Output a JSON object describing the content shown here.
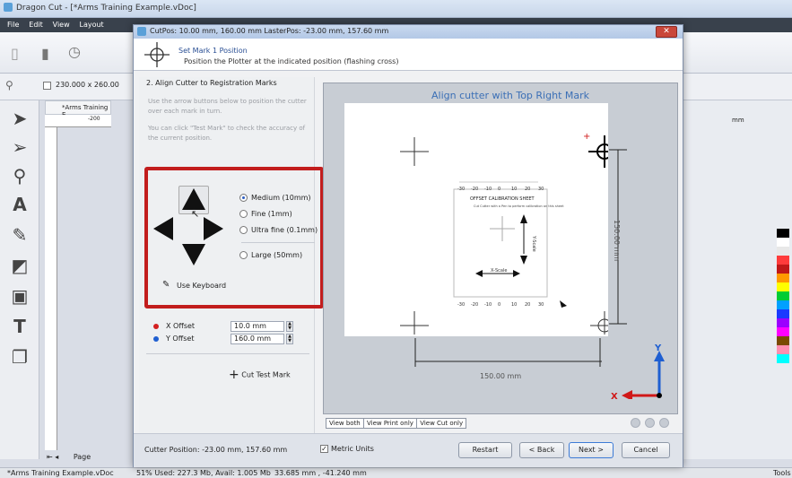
{
  "app": {
    "title": "Dragon Cut - [*Arms Training Example.vDoc]",
    "menu": [
      "File",
      "Edit",
      "View",
      "Layout"
    ],
    "doc_size": "230.000 x 260.00",
    "doc_tab": "*Arms Training E",
    "ruler_mark": "-200",
    "page_label": "Page",
    "status_file": "*Arms Training Example.vDoc",
    "status_mem": "51%  Used: 227.3 Mb, Avail: 1.005 Mb",
    "status_pos": "33.685 mm , -41.240 mm",
    "tools_label": "Tools",
    "right_unit": "mm",
    "palette": [
      "#000000",
      "#ffffff",
      "#e8e8e8",
      "#ff3b3b",
      "#c01818",
      "#ff9900",
      "#ffff00",
      "#00cc33",
      "#00a0ff",
      "#1a3aff",
      "#9b00ff",
      "#ff00ff",
      "#7a4a00",
      "#ff8fb0",
      "#00ffff"
    ]
  },
  "dialog": {
    "title": "CutPos: 10.00 mm, 160.00 mm  LasterPos: -23.00 mm, 157.60 mm",
    "close": "✕",
    "head_title": "Set Mark 1 Position",
    "head_subtitle": "Position the Plotter at the indicated position (flashing cross)",
    "section_title": "2. Align Cutter to Registration Marks",
    "hint1": "Use the arrow buttons below to position the cutter over each mark in turn.",
    "hint2": "You can click \"Test Mark\" to check the accuracy of the current position.",
    "step_options": [
      "Medium (10mm)",
      "Fine (1mm)",
      "Ultra fine (0.1mm)"
    ],
    "large_option": "Large (50mm)",
    "keyboard": "Use Keyboard",
    "x_offset_label": "X Offset",
    "y_offset_label": "Y Offset",
    "x_offset_value": "10.0 mm",
    "y_offset_value": "160.0 mm",
    "cut_test": "Cut Test Mark",
    "preview_title": "Align cutter with Top Right Mark",
    "dim_width": "150.00 mm",
    "dim_height": "150.00 mm",
    "calib_title": "OFFSET CALIBRATION SHEET",
    "calib_sub": "Cut Cutter with a Pen to perform calibration on this sheet",
    "xscale": "X-Scale",
    "yscale": "Y-Scale",
    "scale_ticks": [
      "-30",
      "-20",
      "-10",
      "0",
      "10",
      "20",
      "30"
    ],
    "axis_x": "X",
    "axis_y": "Y",
    "tabs": [
      "View both",
      "View Print only",
      "View Cut only"
    ],
    "cutter_position": "Cutter Position: -23.00 mm, 157.60 mm",
    "metric": "Metric Units",
    "buttons": {
      "restart": "Restart",
      "back": "< Back",
      "next": "Next >",
      "cancel": "Cancel"
    }
  }
}
